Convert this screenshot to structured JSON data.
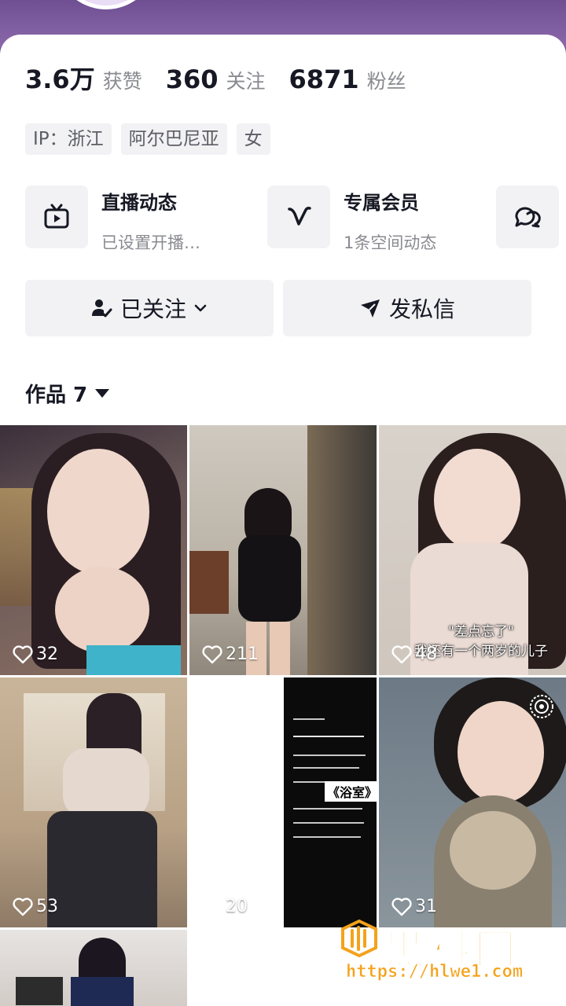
{
  "profile": {
    "stats": [
      {
        "value": "3.6万",
        "label": "获赞"
      },
      {
        "value": "360",
        "label": "关注"
      },
      {
        "value": "6871",
        "label": "粉丝"
      }
    ],
    "tags": [
      "IP：浙江",
      "阿尔巴尼亚",
      "女"
    ]
  },
  "features": [
    {
      "title": "直播动态",
      "subtitle": "已设置开播…",
      "icon": "tv-icon"
    },
    {
      "title": "专属会员",
      "subtitle": "1条空间动态",
      "icon": "v-logo-icon"
    },
    {
      "title": "",
      "subtitle": "",
      "icon": "chat-bubbles-icon"
    }
  ],
  "actions": {
    "follow_label": "已关注",
    "message_label": "发私信"
  },
  "works": {
    "tab_label": "作品 7"
  },
  "videos": [
    {
      "likes": "32"
    },
    {
      "likes": "211"
    },
    {
      "likes": "48",
      "caption_line1": "\"差点忘了\"",
      "caption_line2": "我还有一个两岁的儿子"
    },
    {
      "likes": "53"
    },
    {
      "likes": "20",
      "text_title": "《浴室》"
    },
    {
      "likes": "31"
    },
    {
      "likes": ""
    }
  ],
  "watermark": {
    "title": "黑料网",
    "url": "https://hlwe1.com"
  },
  "colors": {
    "header_purple": "#7d5c9c",
    "text_primary": "#161823",
    "text_secondary": "#8a8b91",
    "chip_bg": "#f2f2f4",
    "watermark_orange": "#f4a21b"
  }
}
